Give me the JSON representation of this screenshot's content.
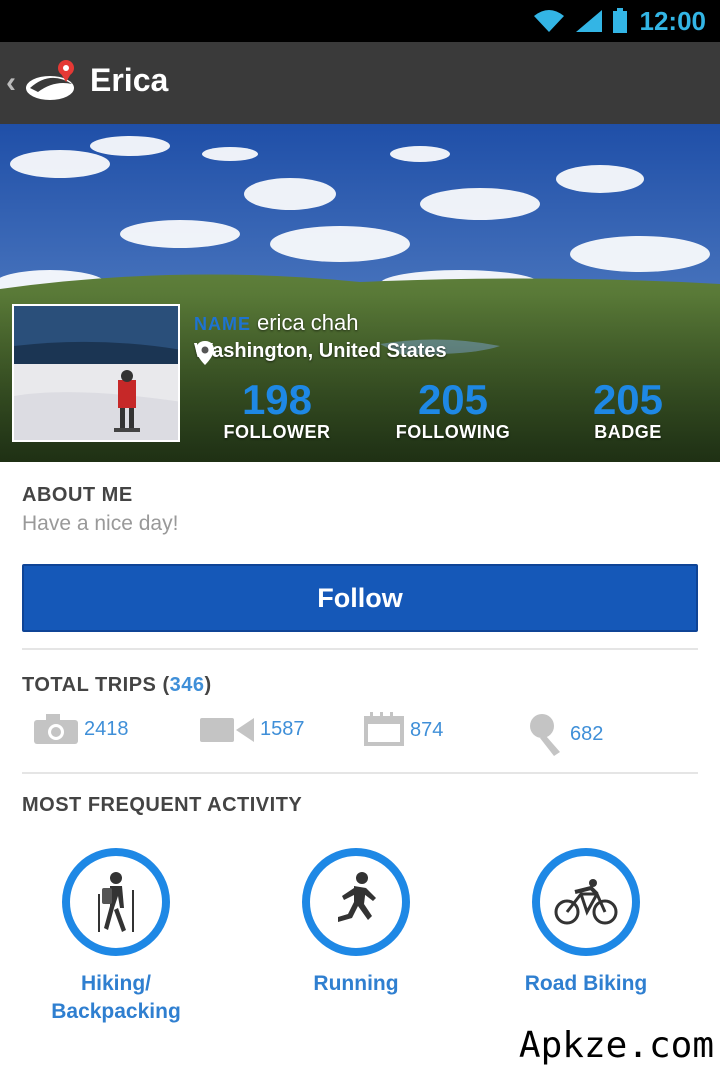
{
  "status_bar": {
    "time": "12:00"
  },
  "action_bar": {
    "title": "Erica"
  },
  "profile": {
    "name_label": "NAME",
    "name": "erica chah",
    "location": "Washington, United States",
    "stats": [
      {
        "value": "198",
        "label": "FOLLOWER"
      },
      {
        "value": "205",
        "label": "FOLLOWING"
      },
      {
        "value": "205",
        "label": "BADGE"
      }
    ]
  },
  "about": {
    "title": "ABOUT ME",
    "text": "Have a nice day!"
  },
  "follow_button": {
    "label": "Follow"
  },
  "trips": {
    "title": "TOTAL TRIPS (",
    "count": "346",
    "title_close": ")",
    "items": [
      {
        "icon": "camera-icon",
        "value": "2418"
      },
      {
        "icon": "video-icon",
        "value": "1587"
      },
      {
        "icon": "journal-icon",
        "value": "874"
      },
      {
        "icon": "microphone-icon",
        "value": "682"
      }
    ]
  },
  "activity": {
    "title": "MOST FREQUENT ACTIVITY",
    "items": [
      {
        "icon": "hiking-icon",
        "line1": "Hiking/",
        "line2": "Backpacking"
      },
      {
        "icon": "running-icon",
        "line1": "Running",
        "line2": ""
      },
      {
        "icon": "road-biking-icon",
        "line1": "Road Biking",
        "line2": ""
      }
    ]
  },
  "watermark": "Apkze.com",
  "colors": {
    "accent": "#1e88e5",
    "button": "#1558b8",
    "action_bar": "#3a3a3a"
  }
}
